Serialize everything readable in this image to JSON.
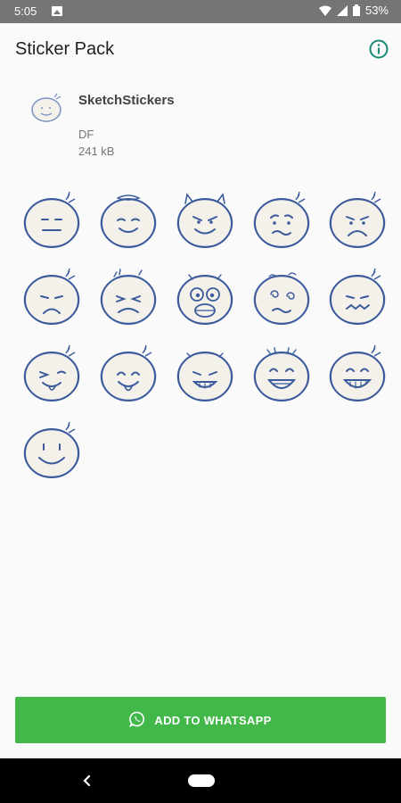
{
  "status_bar": {
    "time": "5:05",
    "battery": "53%"
  },
  "app_bar": {
    "title": "Sticker Pack",
    "info_icon": "info-icon"
  },
  "pack": {
    "name": "SketchStickers",
    "publisher": "DF",
    "size": "241 kB"
  },
  "stickers": [
    {
      "name": "sticker-neutral"
    },
    {
      "name": "sticker-angel-smile"
    },
    {
      "name": "sticker-devil-grin"
    },
    {
      "name": "sticker-worried"
    },
    {
      "name": "sticker-sad"
    },
    {
      "name": "sticker-frown"
    },
    {
      "name": "sticker-angry"
    },
    {
      "name": "sticker-shocked"
    },
    {
      "name": "sticker-dizzy"
    },
    {
      "name": "sticker-grimace"
    },
    {
      "name": "sticker-tongue-wink"
    },
    {
      "name": "sticker-tongue-happy"
    },
    {
      "name": "sticker-evil-grin"
    },
    {
      "name": "sticker-laugh"
    },
    {
      "name": "sticker-big-grin"
    },
    {
      "name": "sticker-smile"
    }
  ],
  "add_button": {
    "label": "ADD TO WHATSAPP",
    "color": "#43b84a"
  },
  "colors": {
    "sketch_stroke": "#3a5a9c",
    "sticker_fill": "#f3f1ea"
  }
}
